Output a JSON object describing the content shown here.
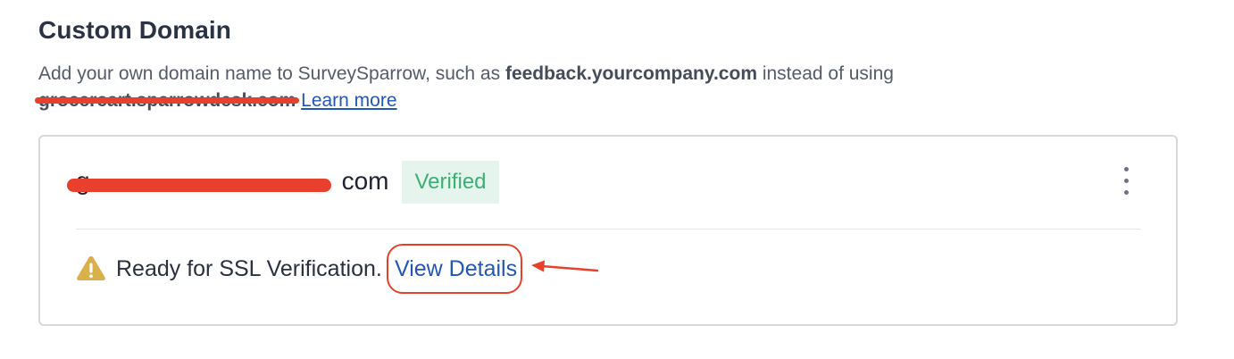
{
  "section": {
    "title": "Custom Domain",
    "description_prefix": "Add your own domain name to SurveySparrow, such as ",
    "example_domain": "feedback.yourcompany.com",
    "description_suffix": " instead of using ",
    "old_domain": "grocercart.sparrowdesk.com",
    "learn_more_label": "Learn more"
  },
  "domain_card": {
    "domain_name_start": "g",
    "domain_name_end": "com",
    "status_badge": "Verified",
    "ssl_message": "Ready for SSL Verification.",
    "view_details_label": "View Details"
  },
  "colors": {
    "accent_link": "#2357b5",
    "verified_text": "#3fae74",
    "verified_bg": "#e5f4ec",
    "warning": "#d9b04a",
    "annotation_red": "#e8402d"
  },
  "icons": {
    "menu": "kebab-menu-icon",
    "warning": "warning-icon"
  }
}
